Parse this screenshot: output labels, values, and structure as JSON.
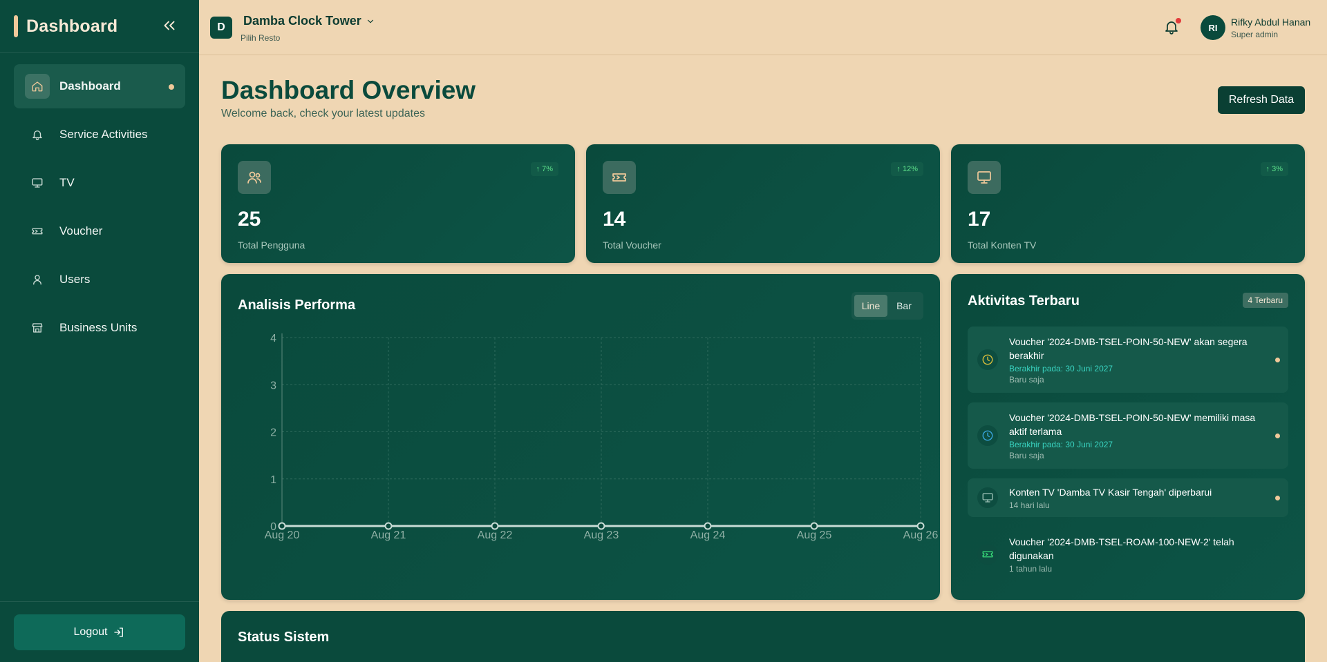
{
  "sidebar": {
    "title": "Dashboard",
    "items": [
      {
        "label": "Dashboard",
        "icon": "home-icon",
        "active": true
      },
      {
        "label": "Service Activities",
        "icon": "bell-icon"
      },
      {
        "label": "TV",
        "icon": "monitor-icon"
      },
      {
        "label": "Voucher",
        "icon": "ticket-icon"
      },
      {
        "label": "Users",
        "icon": "user-icon"
      },
      {
        "label": "Business Units",
        "icon": "store-icon"
      }
    ],
    "logout_label": "Logout"
  },
  "topbar": {
    "resto_initial": "D",
    "resto_name": "Damba Clock Tower",
    "resto_sub": "Pilih Resto",
    "user_initials": "RI",
    "user_name": "Rifky Abdul Hanan",
    "user_role": "Super admin"
  },
  "header": {
    "title": "Dashboard Overview",
    "subtitle": "Welcome back, check your latest updates",
    "refresh_label": "Refresh Data"
  },
  "stats": [
    {
      "value": "25",
      "label": "Total Pengguna",
      "change": "7%",
      "icon": "users-icon"
    },
    {
      "value": "14",
      "label": "Total Voucher",
      "change": "12%",
      "icon": "ticket-icon"
    },
    {
      "value": "17",
      "label": "Total Konten TV",
      "change": "3%",
      "icon": "monitor-icon"
    }
  ],
  "performance": {
    "title": "Analisis Performa",
    "toggle_line": "Line",
    "toggle_bar": "Bar"
  },
  "chart_data": {
    "type": "line",
    "categories": [
      "Aug 20",
      "Aug 21",
      "Aug 22",
      "Aug 23",
      "Aug 24",
      "Aug 25",
      "Aug 26"
    ],
    "series": [
      {
        "values": [
          0,
          0,
          0,
          0,
          0,
          0,
          0
        ]
      }
    ],
    "yticks": [
      0,
      1,
      2,
      3,
      4
    ],
    "ylim": [
      0,
      4
    ],
    "grid": true,
    "colors": {
      "line": "#c9dcd6",
      "grid": "#2e6a5c",
      "tick": "#8fb0a5"
    }
  },
  "activities": {
    "title": "Aktivitas Terbaru",
    "badge": "4 Terbaru",
    "items": [
      {
        "title": "Voucher '2024-DMB-TSEL-POIN-50-NEW' akan segera berakhir",
        "meta": "Berakhir pada: 30 Juni 2027",
        "time": "Baru saja",
        "icon": "clock-icon",
        "color": "#e2c23a"
      },
      {
        "title": "Voucher '2024-DMB-TSEL-POIN-50-NEW' memiliki masa aktif terlama",
        "meta": "Berakhir pada: 30 Juni 2027",
        "time": "Baru saja",
        "icon": "clock-icon",
        "color": "#3aa7e2"
      },
      {
        "title": "Konten TV 'Damba TV Kasir Tengah' diperbarui",
        "time": "14 hari lalu",
        "icon": "monitor-icon",
        "color": "#9fc3b8"
      },
      {
        "title": "Voucher '2024-DMB-TSEL-ROAM-100-NEW-2' telah digunakan",
        "time": "1 tahun lalu",
        "icon": "ticket-icon",
        "color": "#3be07c"
      }
    ]
  },
  "status": {
    "title": "Status Sistem"
  }
}
